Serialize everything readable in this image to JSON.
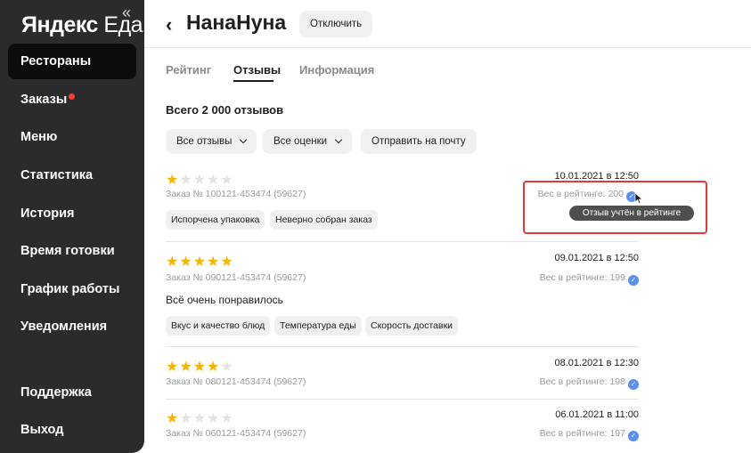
{
  "sidebar": {
    "logo_part1": "Яндекс",
    "logo_part2": "Еда",
    "collapse_glyph": "«",
    "items": [
      {
        "label": "Рестораны"
      },
      {
        "label": "Заказы"
      },
      {
        "label": "Меню"
      },
      {
        "label": "Статистика"
      },
      {
        "label": "История"
      },
      {
        "label": "Время готовки"
      },
      {
        "label": "График работы"
      },
      {
        "label": "Уведомления"
      },
      {
        "label": "Поддержка"
      },
      {
        "label": "Выход"
      }
    ]
  },
  "header": {
    "title": "НанаНуна",
    "disable_label": "Отключить"
  },
  "tabs": [
    {
      "label": "Рейтинг"
    },
    {
      "label": "Отзывы"
    },
    {
      "label": "Информация"
    }
  ],
  "total": "Всего 2 000 отзывов",
  "filters": {
    "all_reviews": "Все отзывы",
    "all_ratings": "Все оценки",
    "send_email": "Отправить на почту"
  },
  "reviews": [
    {
      "rating": 1,
      "date": "10.01.2021 в 12:50",
      "order": "Заказ № 100121-453474 (59627)",
      "weight": "Вес в рейтинге: 200",
      "comment": "",
      "tags": [
        "Испорчена упаковка",
        "Неверно собран заказ"
      ]
    },
    {
      "rating": 5,
      "date": "09.01.2021 в 12:50",
      "order": "Заказ № 090121-453474 (59627)",
      "weight": "Вес в рейтинге: 199",
      "comment": "Всё очень понравилось",
      "tags": [
        "Вкус и качество блюд",
        "Температура еды",
        "Скорость доставки"
      ]
    },
    {
      "rating": 4,
      "date": "08.01.2021 в 12:30",
      "order": "Заказ № 080121-453474 (59627)",
      "weight": "Вес в рейтинге: 198",
      "comment": "",
      "tags": []
    },
    {
      "rating": 1,
      "date": "06.01.2021 в 11:00",
      "order": "Заказ № 060121-453474 (59627)",
      "weight": "Вес в рейтинге: 197",
      "comment": "",
      "tags": []
    }
  ],
  "tooltip": "Отзыв учтён в рейтинге",
  "icons": {
    "check": "✓",
    "star": "★",
    "back": "‹"
  },
  "colors": {
    "sidebar_bg": "#2b2b2d",
    "star_on": "#f5b400",
    "star_off": "#e3e3e3",
    "verified": "#5a8ef0",
    "highlight": "#e03a3a",
    "notification_dot": "#ff3b30"
  }
}
